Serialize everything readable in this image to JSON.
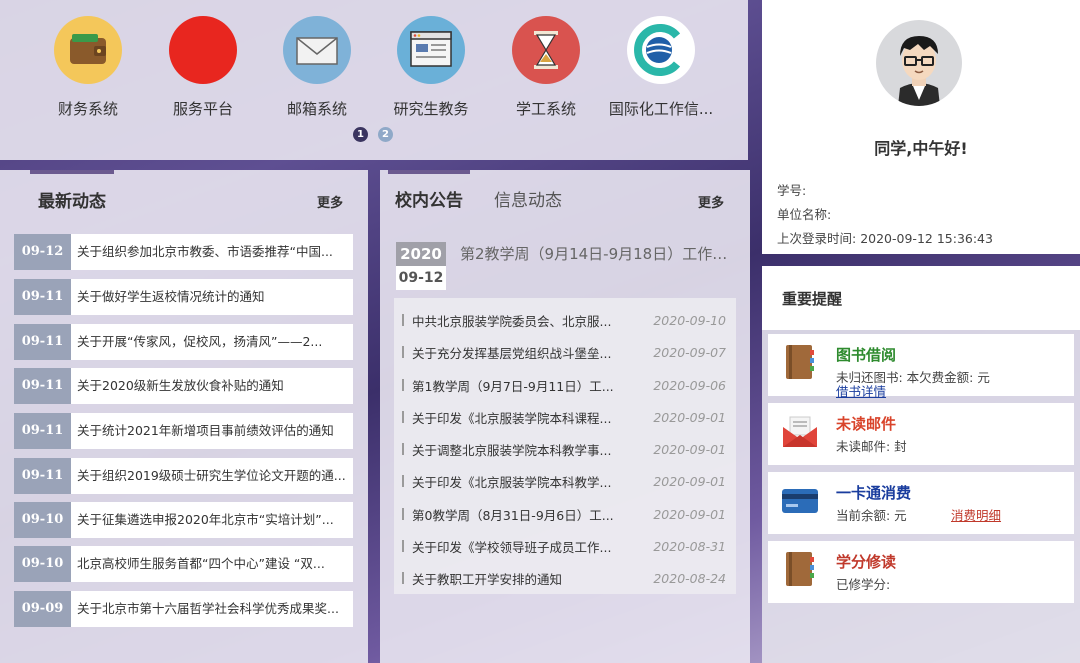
{
  "apps": [
    {
      "label": "财务系统",
      "icon": "wallet-icon",
      "color": "#f4c75a"
    },
    {
      "label": "服务平台",
      "icon": "service-icon",
      "color": "#e8261f"
    },
    {
      "label": "邮箱系统",
      "icon": "mail-icon",
      "color": "#7fb2d8"
    },
    {
      "label": "研究生教务",
      "icon": "browser-icon",
      "color": "#6ab0d8"
    },
    {
      "label": "学工系统",
      "icon": "hourglass-icon",
      "color": "#d9534f"
    },
    {
      "label": "国际化工作信...",
      "icon": "globe-icon",
      "color": "#2ab7a9"
    }
  ],
  "pagination": [
    "1",
    "2"
  ],
  "news": {
    "title": "最新动态",
    "more": "更多",
    "items": [
      {
        "date": "09-12",
        "text": "关于组织参加北京市教委、市语委推荐“中国..."
      },
      {
        "date": "09-11",
        "text": "关于做好学生返校情况统计的通知"
      },
      {
        "date": "09-11",
        "text": "关于开展“传家风，促校风，扬清风”——2..."
      },
      {
        "date": "09-11",
        "text": "关于2020级新生发放伙食补贴的通知"
      },
      {
        "date": "09-11",
        "text": "关于统计2021年新增项目事前绩效评估的通知"
      },
      {
        "date": "09-11",
        "text": "关于组织2019级硕士研究生学位论文开题的通..."
      },
      {
        "date": "09-10",
        "text": "关于征集遴选申报2020年北京市“实培计划”..."
      },
      {
        "date": "09-10",
        "text": "北京高校师生服务首都“四个中心”建设 “双..."
      },
      {
        "date": "09-09",
        "text": "关于北京市第十六届哲学社会科学优秀成果奖..."
      }
    ]
  },
  "announce": {
    "tabs": [
      "校内公告",
      "信息动态"
    ],
    "more": "更多",
    "feature": {
      "year": "2020",
      "date": "09-12",
      "title": "第2教学周（9月14日-9月18日）工作安..."
    },
    "items": [
      {
        "text": "中共北京服装学院委员会、北京服...",
        "date": "2020-09-10"
      },
      {
        "text": "关于充分发挥基层党组织战斗堡垒...",
        "date": "2020-09-07"
      },
      {
        "text": "第1教学周（9月7日-9月11日）工...",
        "date": "2020-09-06"
      },
      {
        "text": "关于印发《北京服装学院本科课程...",
        "date": "2020-09-01"
      },
      {
        "text": "关于调整北京服装学院本科教学事...",
        "date": "2020-09-01"
      },
      {
        "text": "关于印发《北京服装学院本科教学...",
        "date": "2020-09-01"
      },
      {
        "text": "第0教学周（8月31日-9月6日）工...",
        "date": "2020-09-01"
      },
      {
        "text": "关于印发《学校领导班子成员工作...",
        "date": "2020-08-31"
      },
      {
        "text": "关于教职工开学安排的通知",
        "date": "2020-08-24"
      }
    ]
  },
  "profile": {
    "greeting": "同学,中午好!",
    "student_id_label": "学号:",
    "unit_label": "单位名称:",
    "last_login_label": "上次登录时间:",
    "last_login_value": "2020-09-12 15:36:43"
  },
  "reminders": {
    "title": "重要提醒",
    "cards": [
      {
        "title": "图书借阅",
        "title_color": "#2e8b2e",
        "icon": "book-icon",
        "sub": "未归还图书:      本欠费金额:      元",
        "link": "借书详情",
        "link_color": "#1a3d9e"
      },
      {
        "title": "未读邮件",
        "title_color": "#d9442b",
        "icon": "envelope-icon",
        "sub": "未读邮件:      封",
        "link": "",
        "link_color": ""
      },
      {
        "title": "一卡通消费",
        "title_color": "#1a3d9e",
        "icon": "card-icon",
        "sub": "当前余额:            元",
        "link": "消费明细",
        "link_color": "#c0392b"
      },
      {
        "title": "学分修读",
        "title_color": "#c0392b",
        "icon": "credit-book-icon",
        "sub": "已修学分:",
        "link": "",
        "link_color": ""
      }
    ]
  }
}
